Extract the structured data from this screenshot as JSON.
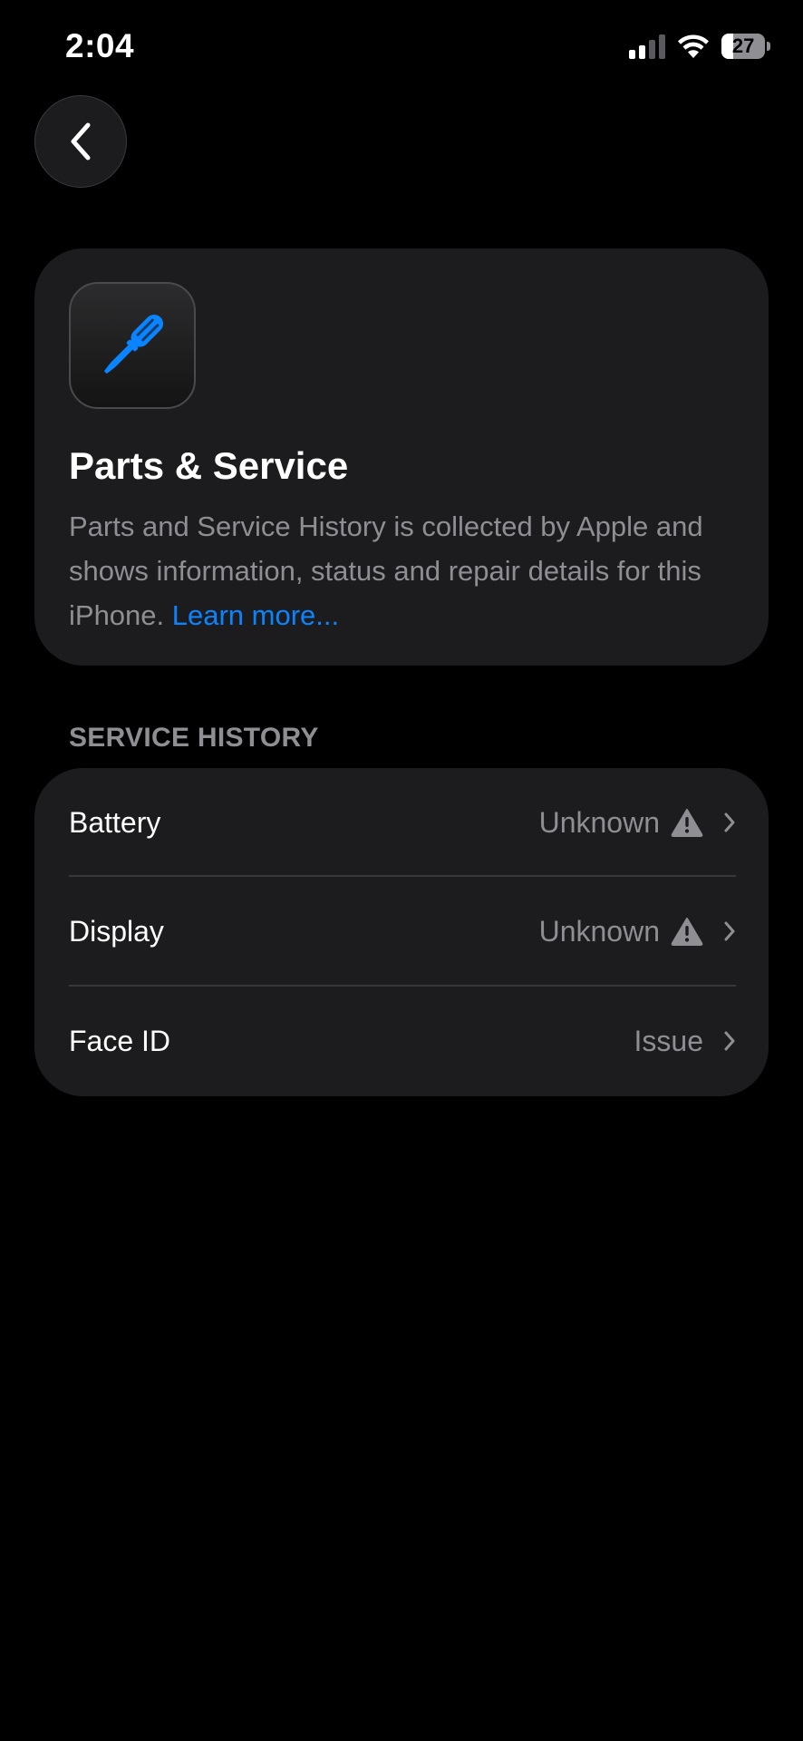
{
  "status_bar": {
    "time": "2:04",
    "battery_level": "27",
    "battery_fraction": 0.27,
    "signal_bars_active": 2,
    "signal_bars_total": 4
  },
  "back_button": {
    "icon": "chevron-left-icon"
  },
  "info_card": {
    "icon": "screwdriver-icon",
    "icon_color": "#0a84ff",
    "title": "Parts & Service",
    "description": "Parts and Service History is collected by Apple and shows information, status and repair details for this iPhone. ",
    "learn_more": "Learn more..."
  },
  "service_history": {
    "header": "SERVICE HISTORY",
    "rows": [
      {
        "label": "Battery",
        "value": "Unknown",
        "warning": true
      },
      {
        "label": "Display",
        "value": "Unknown",
        "warning": true
      },
      {
        "label": "Face ID",
        "value": "Issue",
        "warning": false
      }
    ]
  },
  "colors": {
    "background": "#000000",
    "card": "#1c1c1e",
    "accent": "#0a84ff",
    "secondary_text": "#8e8e93"
  }
}
